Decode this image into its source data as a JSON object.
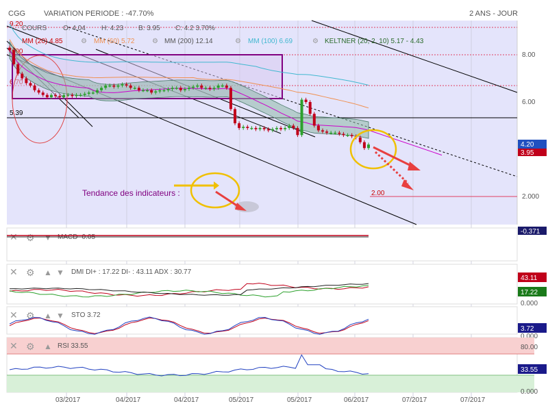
{
  "header": {
    "symbol": "CGG",
    "variation": "VARIATION PERIODE : -47.70%",
    "period": "2 ANS - JOUR"
  },
  "legend": {
    "cours": "COURS",
    "open": "O: 4.04",
    "high": "H: 4.23",
    "low": "B: 3.95",
    "close": "C: 4.2 3.70%",
    "mm20": "MM (20) 4.85",
    "mm60": "MM (60) 5.72",
    "mm200": "MM (200) 12.14",
    "mm100": "MM (100) 6.69",
    "keltner": "KELTNER (20, 2, 10) 5.17 - 4.43"
  },
  "annotations": {
    "tendance": "Tendance des indicateurs :",
    "level_539": "5.39",
    "level_200": "2.00",
    "level_920": "9.20",
    "level_800": "8.00",
    "level_670": "6.70"
  },
  "colors": {
    "price_bg": "#e4e4fb",
    "up": "#2ca02c",
    "down": "#c0001a",
    "mm20": "#cc00cc",
    "mm60": "#f09050",
    "mm100": "#40b8d0",
    "keltner_fill": "#8fb8a8",
    "rect": "#800080",
    "arrow": "#e84040",
    "circle": "#f0c000",
    "rsi_over": "#f8d0d0",
    "rsi_under": "#d8f0d8"
  },
  "panels": {
    "macd": {
      "label": "MACD -0.05",
      "badge": "-0.371"
    },
    "dmi": {
      "label": "DMI DI+ : 17.22 DI- : 43.11 ADX : 30.77",
      "badge_red": "43.11",
      "badge_green": "17.22",
      "zero": "0.000"
    },
    "sto": {
      "label": "STO 3.72",
      "badge": "3.72",
      "zero": "0.000"
    },
    "rsi": {
      "label": "RSI 33.55",
      "badge": "33.55",
      "level80": "80.00",
      "zero": "0.000"
    }
  },
  "chart_data": {
    "type": "candlestick",
    "x_tick_labels": [
      "03/2017",
      "04/2017",
      "04/2017",
      "05/2017",
      "05/2017",
      "06/2017",
      "07/2017",
      "07/2017"
    ],
    "y_ticks": [
      2,
      4,
      6,
      8
    ],
    "y_tick_labels": [
      "2.000",
      "4.00",
      "6.00",
      "8.00"
    ],
    "ylim": [
      0.8,
      9.3
    ],
    "current_price_badge": "4.20",
    "current_price_badge2": "3.95",
    "horizontal_levels": [
      9.2,
      8.0,
      6.7,
      5.39,
      2.0
    ],
    "close": [
      8.2,
      7.6,
      7.2,
      7.0,
      6.8,
      6.7,
      6.5,
      6.4,
      6.3,
      6.2,
      6.3,
      6.25,
      6.2,
      6.3,
      6.3,
      6.25,
      6.3,
      6.3,
      6.35,
      6.4,
      6.4,
      6.5,
      6.6,
      6.7,
      6.7,
      6.65,
      6.7,
      6.75,
      6.7,
      6.6,
      6.6,
      6.5,
      6.5,
      6.5,
      6.4,
      6.45,
      6.5,
      6.5,
      6.55,
      6.6,
      6.6,
      6.5,
      6.55,
      6.6,
      6.65,
      6.7,
      6.6,
      6.6,
      6.55,
      6.6,
      6.7,
      6.7,
      6.6,
      5.7,
      5.1,
      4.9,
      4.95,
      4.9,
      4.9,
      4.85,
      4.9,
      4.85,
      4.8,
      4.85,
      4.9,
      4.85,
      4.9,
      5.0,
      4.9,
      4.6,
      6.1,
      6.0,
      5.5,
      5.0,
      4.8,
      4.75,
      4.7,
      4.7,
      4.7,
      4.65,
      4.6,
      4.6,
      4.55,
      4.5,
      4.3,
      4.05,
      4.2
    ]
  }
}
